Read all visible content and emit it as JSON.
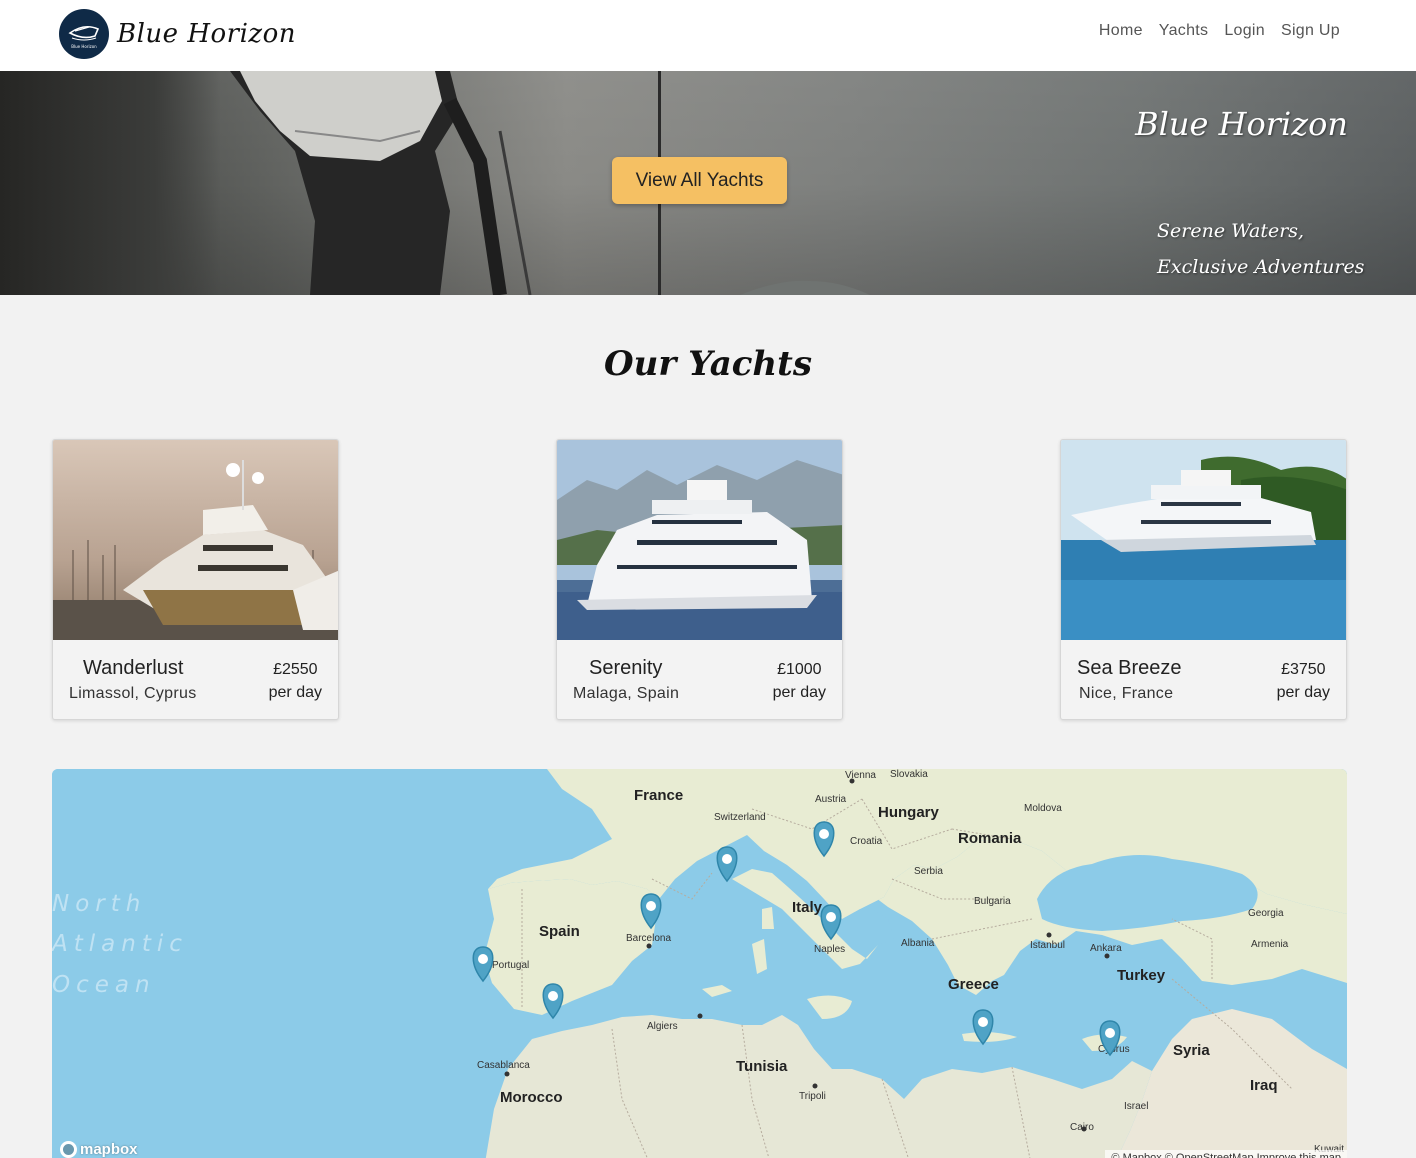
{
  "navbar": {
    "brand": "Blue Horizon",
    "links": [
      "Home",
      "Yachts",
      "Login",
      "Sign Up"
    ]
  },
  "hero": {
    "button": "View All Yachts",
    "title": "Blue Horizon",
    "tagline_1": "Serene Waters,",
    "tagline_2": "Exclusive Adventures"
  },
  "section_title": "Our Yachts",
  "yachts": [
    {
      "name": "Wanderlust",
      "location": "Limassol, Cyprus",
      "price": "£2550",
      "unit": "per day"
    },
    {
      "name": "Serenity",
      "location": "Malaga, Spain",
      "price": "£1000",
      "unit": "per day"
    },
    {
      "name": "Sea Breeze",
      "location": "Nice, France",
      "price": "£3750",
      "unit": "per day"
    }
  ],
  "map": {
    "labels": {
      "france": "France",
      "vienna": "Vienna",
      "slovakia": "Slovakia",
      "austria": "Austria",
      "hungary": "Hungary",
      "moldova": "Moldova",
      "switzerland": "Switzerland",
      "croatia": "Croatia",
      "romania": "Romania",
      "serbia": "Serbia",
      "italy": "Italy",
      "bulgaria": "Bulgaria",
      "georgia": "Georgia",
      "spain": "Spain",
      "barcelona": "Barcelona",
      "albania": "Albania",
      "istanbul": "Istanbul",
      "ankara": "Ankara",
      "armenia": "Armenia",
      "naples": "Naples",
      "portugal": "Portugal",
      "turkey": "Turkey",
      "greece": "Greece",
      "algiers": "Algiers",
      "cyprus": "Cyprus",
      "syria": "Syria",
      "casablanca": "Casablanca",
      "tunisia": "Tunisia",
      "iraq": "Iraq",
      "morocco": "Morocco",
      "tripoli": "Tripoli",
      "israel": "Israel",
      "cairo": "Cairo",
      "kuwait": "Kuwait",
      "ocean_1": "North",
      "ocean_2": "Atlantic",
      "ocean_3": "Ocean"
    },
    "logo": "mapbox",
    "attribution": "© Mapbox © OpenStreetMap Improve this map"
  }
}
